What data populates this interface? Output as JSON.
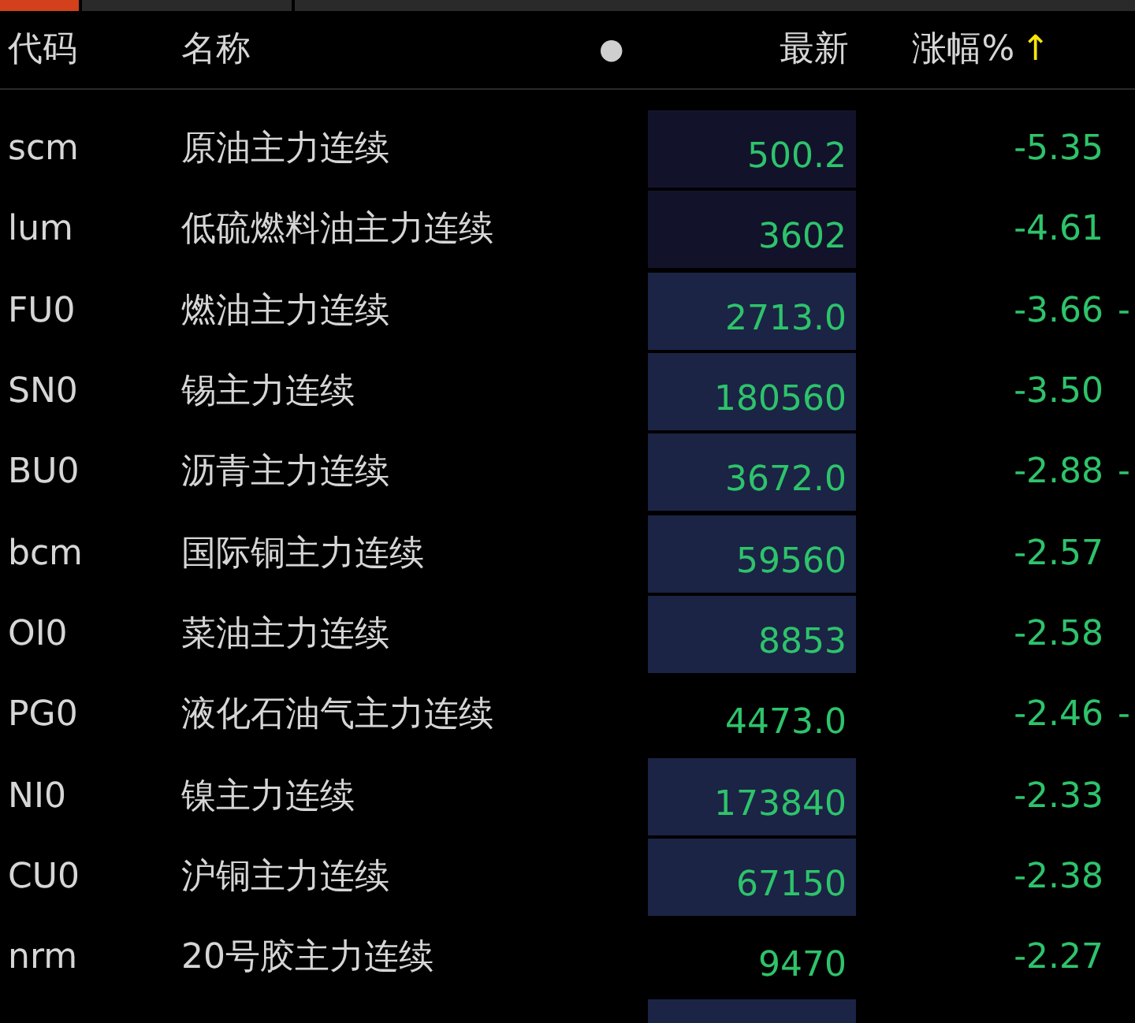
{
  "tabs": [
    {
      "selected": true
    },
    {
      "selected": false
    },
    {
      "selected": false
    }
  ],
  "header": {
    "code": "代码",
    "name": "名称",
    "dot": "●",
    "price": "最新",
    "change": "涨幅%",
    "sort_arrow": "↑"
  },
  "rows": [
    {
      "code": "scm",
      "name": "原油主力连续",
      "price": "500.2",
      "change": "-5.35",
      "highlighted": true,
      "dark": true
    },
    {
      "code": "lum",
      "name": "低硫燃料油主力连续",
      "price": "3602",
      "change": "-4.61",
      "highlighted": true,
      "dark": true
    },
    {
      "code": "FU0",
      "name": "燃油主力连续",
      "price": "2713.0",
      "change": "-3.66",
      "highlighted": true,
      "dark": false,
      "column_5": "-"
    },
    {
      "code": "SN0",
      "name": "锡主力连续",
      "price": "180560",
      "change": "-3.50",
      "highlighted": true,
      "dark": false
    },
    {
      "code": "BU0",
      "name": "沥青主力连续",
      "price": "3672.0",
      "change": "-2.88",
      "highlighted": true,
      "dark": false,
      "column_5": "-"
    },
    {
      "code": "bcm",
      "name": "国际铜主力连续",
      "price": "59560",
      "change": "-2.57",
      "highlighted": true,
      "dark": false
    },
    {
      "code": "OI0",
      "name": "菜油主力连续",
      "price": "8853",
      "change": "-2.58",
      "highlighted": true,
      "dark": false
    },
    {
      "code": "PG0",
      "name": "液化石油气主力连续",
      "price": "4473.0",
      "change": "-2.46",
      "highlighted": false,
      "column_5": "-"
    },
    {
      "code": "NI0",
      "name": "镍主力连续",
      "price": "173840",
      "change": "-2.33",
      "highlighted": true,
      "dark": false
    },
    {
      "code": "CU0",
      "name": "沪铜主力连续",
      "price": "67150",
      "change": "-2.38",
      "highlighted": true,
      "dark": false
    },
    {
      "code": "nrm",
      "name": "20号胶主力连续",
      "price": "9470",
      "change": "-2.27",
      "highlighted": false
    },
    {
      "highlighted": true,
      "dark": false
    }
  ]
}
